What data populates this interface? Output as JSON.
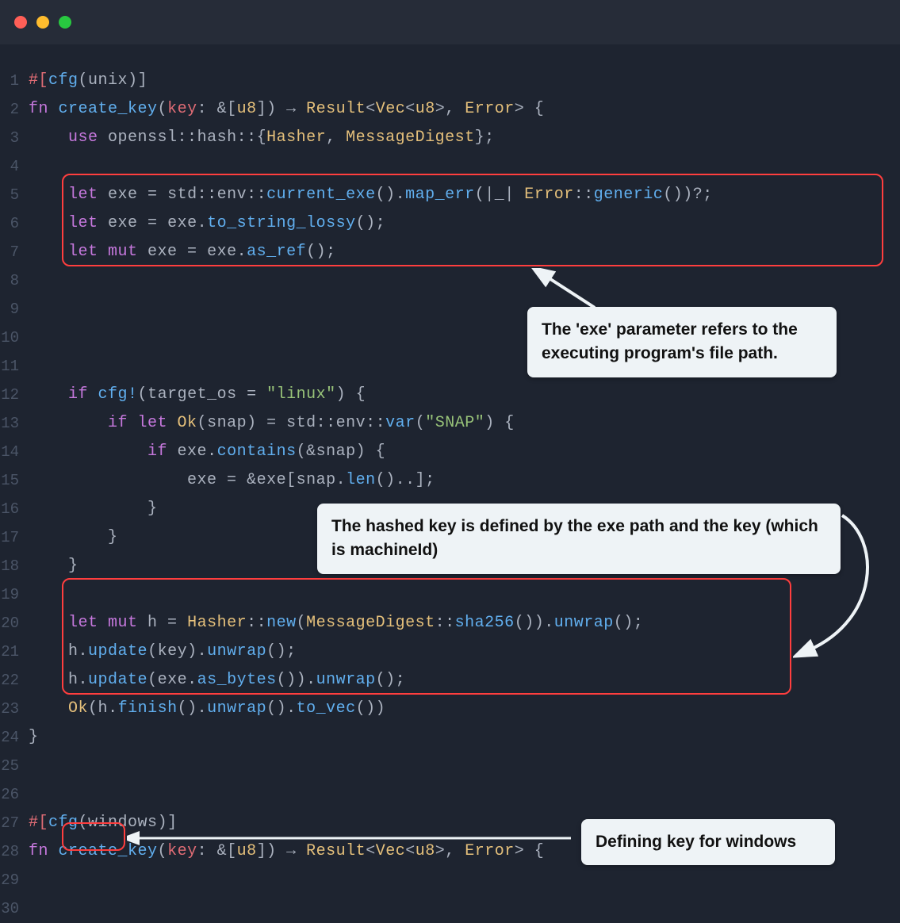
{
  "traffic_lights": [
    "red",
    "yellow",
    "green"
  ],
  "annotations": {
    "callout1": "The 'exe' parameter refers to the executing program's file path.",
    "callout2": "The hashed key is defined by the exe path and the key (which is machineId)",
    "callout3": "Defining key for windows"
  },
  "code": {
    "lines": [
      {
        "n": 1,
        "tokens": [
          [
            "tk-plain",
            "#["
          ],
          [
            "tk-call",
            "cfg"
          ],
          [
            "tk-punc",
            "("
          ],
          [
            "tk-ident",
            "unix"
          ],
          [
            "tk-punc",
            ")]"
          ]
        ]
      },
      {
        "n": 2,
        "tokens": [
          [
            "tk-kw",
            "fn "
          ],
          [
            "tk-fn",
            "create_key"
          ],
          [
            "tk-punc",
            "("
          ],
          [
            "tk-param",
            "key"
          ],
          [
            "tk-punc",
            ": "
          ],
          [
            "tk-op",
            "&"
          ],
          [
            "tk-punc",
            "["
          ],
          [
            "tk-type",
            "u8"
          ],
          [
            "tk-punc",
            "]) "
          ],
          [
            "tk-op",
            "→ "
          ],
          [
            "tk-type",
            "Result"
          ],
          [
            "tk-punc",
            "<"
          ],
          [
            "tk-type",
            "Vec"
          ],
          [
            "tk-punc",
            "<"
          ],
          [
            "tk-type",
            "u8"
          ],
          [
            "tk-punc",
            ">, "
          ],
          [
            "tk-type",
            "Error"
          ],
          [
            "tk-punc",
            "> {"
          ]
        ]
      },
      {
        "n": 3,
        "tokens": [
          [
            "tk-punc",
            "    "
          ],
          [
            "tk-kw",
            "use "
          ],
          [
            "tk-ident",
            "openssl"
          ],
          [
            "tk-op",
            "::"
          ],
          [
            "tk-ident",
            "hash"
          ],
          [
            "tk-op",
            "::"
          ],
          [
            "tk-punc",
            "{"
          ],
          [
            "tk-type",
            "Hasher"
          ],
          [
            "tk-punc",
            ", "
          ],
          [
            "tk-type",
            "MessageDigest"
          ],
          [
            "tk-punc",
            "};"
          ]
        ]
      },
      {
        "n": 4,
        "tokens": []
      },
      {
        "n": 5,
        "tokens": [
          [
            "tk-punc",
            "    "
          ],
          [
            "tk-kw",
            "let "
          ],
          [
            "tk-ident",
            "exe"
          ],
          [
            "tk-op",
            " = "
          ],
          [
            "tk-ident",
            "std"
          ],
          [
            "tk-op",
            "::"
          ],
          [
            "tk-ident",
            "env"
          ],
          [
            "tk-op",
            "::"
          ],
          [
            "tk-call",
            "current_exe"
          ],
          [
            "tk-punc",
            "()."
          ],
          [
            "tk-call",
            "map_err"
          ],
          [
            "tk-punc",
            "(|"
          ],
          [
            "tk-ident",
            "_"
          ],
          [
            "tk-punc",
            "| "
          ],
          [
            "tk-type",
            "Error"
          ],
          [
            "tk-op",
            "::"
          ],
          [
            "tk-call",
            "generic"
          ],
          [
            "tk-punc",
            "())?;"
          ]
        ]
      },
      {
        "n": 6,
        "tokens": [
          [
            "tk-punc",
            "    "
          ],
          [
            "tk-kw",
            "let "
          ],
          [
            "tk-ident",
            "exe"
          ],
          [
            "tk-op",
            " = "
          ],
          [
            "tk-ident",
            "exe"
          ],
          [
            "tk-punc",
            "."
          ],
          [
            "tk-call",
            "to_string_lossy"
          ],
          [
            "tk-punc",
            "();"
          ]
        ]
      },
      {
        "n": 7,
        "tokens": [
          [
            "tk-punc",
            "    "
          ],
          [
            "tk-kw",
            "let mut "
          ],
          [
            "tk-ident",
            "exe"
          ],
          [
            "tk-op",
            " = "
          ],
          [
            "tk-ident",
            "exe"
          ],
          [
            "tk-punc",
            "."
          ],
          [
            "tk-call",
            "as_ref"
          ],
          [
            "tk-punc",
            "();"
          ]
        ]
      },
      {
        "n": 8,
        "tokens": []
      },
      {
        "n": 9,
        "tokens": []
      },
      {
        "n": 10,
        "tokens": []
      },
      {
        "n": 11,
        "tokens": []
      },
      {
        "n": 12,
        "tokens": [
          [
            "tk-punc",
            "    "
          ],
          [
            "tk-kw",
            "if "
          ],
          [
            "tk-call",
            "cfg!"
          ],
          [
            "tk-punc",
            "("
          ],
          [
            "tk-ident",
            "target_os"
          ],
          [
            "tk-op",
            " = "
          ],
          [
            "tk-str",
            "\"linux\""
          ],
          [
            "tk-punc",
            ") {"
          ]
        ]
      },
      {
        "n": 13,
        "tokens": [
          [
            "tk-punc",
            "        "
          ],
          [
            "tk-kw",
            "if let "
          ],
          [
            "tk-type",
            "Ok"
          ],
          [
            "tk-punc",
            "("
          ],
          [
            "tk-ident",
            "snap"
          ],
          [
            "tk-punc",
            ")"
          ],
          [
            "tk-op",
            " = "
          ],
          [
            "tk-ident",
            "std"
          ],
          [
            "tk-op",
            "::"
          ],
          [
            "tk-ident",
            "env"
          ],
          [
            "tk-op",
            "::"
          ],
          [
            "tk-call",
            "var"
          ],
          [
            "tk-punc",
            "("
          ],
          [
            "tk-str",
            "\"SNAP\""
          ],
          [
            "tk-punc",
            ") {"
          ]
        ]
      },
      {
        "n": 14,
        "tokens": [
          [
            "tk-punc",
            "            "
          ],
          [
            "tk-kw",
            "if "
          ],
          [
            "tk-ident",
            "exe"
          ],
          [
            "tk-punc",
            "."
          ],
          [
            "tk-call",
            "contains"
          ],
          [
            "tk-punc",
            "("
          ],
          [
            "tk-op",
            "&"
          ],
          [
            "tk-ident",
            "snap"
          ],
          [
            "tk-punc",
            ") {"
          ]
        ]
      },
      {
        "n": 15,
        "tokens": [
          [
            "tk-punc",
            "                "
          ],
          [
            "tk-ident",
            "exe"
          ],
          [
            "tk-op",
            " = "
          ],
          [
            "tk-op",
            "&"
          ],
          [
            "tk-ident",
            "exe"
          ],
          [
            "tk-punc",
            "["
          ],
          [
            "tk-ident",
            "snap"
          ],
          [
            "tk-punc",
            "."
          ],
          [
            "tk-call",
            "len"
          ],
          [
            "tk-punc",
            "().."
          ],
          [
            "tk-punc",
            "];"
          ]
        ]
      },
      {
        "n": 16,
        "tokens": [
          [
            "tk-punc",
            "            }"
          ]
        ]
      },
      {
        "n": 17,
        "tokens": [
          [
            "tk-punc",
            "        }"
          ]
        ]
      },
      {
        "n": 18,
        "tokens": [
          [
            "tk-punc",
            "    }"
          ]
        ]
      },
      {
        "n": 19,
        "tokens": []
      },
      {
        "n": 20,
        "tokens": [
          [
            "tk-punc",
            "    "
          ],
          [
            "tk-kw",
            "let mut "
          ],
          [
            "tk-ident",
            "h"
          ],
          [
            "tk-op",
            " = "
          ],
          [
            "tk-type",
            "Hasher"
          ],
          [
            "tk-op",
            "::"
          ],
          [
            "tk-call",
            "new"
          ],
          [
            "tk-punc",
            "("
          ],
          [
            "tk-type",
            "MessageDigest"
          ],
          [
            "tk-op",
            "::"
          ],
          [
            "tk-call",
            "sha256"
          ],
          [
            "tk-punc",
            "())."
          ],
          [
            "tk-call",
            "unwrap"
          ],
          [
            "tk-punc",
            "();"
          ]
        ]
      },
      {
        "n": 21,
        "tokens": [
          [
            "tk-punc",
            "    "
          ],
          [
            "tk-ident",
            "h"
          ],
          [
            "tk-punc",
            "."
          ],
          [
            "tk-call",
            "update"
          ],
          [
            "tk-punc",
            "("
          ],
          [
            "tk-ident",
            "key"
          ],
          [
            "tk-punc",
            ")."
          ],
          [
            "tk-call",
            "unwrap"
          ],
          [
            "tk-punc",
            "();"
          ]
        ]
      },
      {
        "n": 22,
        "tokens": [
          [
            "tk-punc",
            "    "
          ],
          [
            "tk-ident",
            "h"
          ],
          [
            "tk-punc",
            "."
          ],
          [
            "tk-call",
            "update"
          ],
          [
            "tk-punc",
            "("
          ],
          [
            "tk-ident",
            "exe"
          ],
          [
            "tk-punc",
            "."
          ],
          [
            "tk-call",
            "as_bytes"
          ],
          [
            "tk-punc",
            "())."
          ],
          [
            "tk-call",
            "unwrap"
          ],
          [
            "tk-punc",
            "();"
          ]
        ]
      },
      {
        "n": 23,
        "tokens": [
          [
            "tk-punc",
            "    "
          ],
          [
            "tk-type",
            "Ok"
          ],
          [
            "tk-punc",
            "("
          ],
          [
            "tk-ident",
            "h"
          ],
          [
            "tk-punc",
            "."
          ],
          [
            "tk-call",
            "finish"
          ],
          [
            "tk-punc",
            "()."
          ],
          [
            "tk-call",
            "unwrap"
          ],
          [
            "tk-punc",
            "()."
          ],
          [
            "tk-call",
            "to_vec"
          ],
          [
            "tk-punc",
            "())"
          ]
        ]
      },
      {
        "n": 24,
        "tokens": [
          [
            "tk-punc",
            "}"
          ]
        ]
      },
      {
        "n": 25,
        "tokens": []
      },
      {
        "n": 26,
        "tokens": []
      },
      {
        "n": 27,
        "tokens": [
          [
            "tk-plain",
            "#["
          ],
          [
            "tk-call",
            "cfg"
          ],
          [
            "tk-punc",
            "("
          ],
          [
            "tk-ident",
            "windows"
          ],
          [
            "tk-punc",
            ")]"
          ]
        ]
      },
      {
        "n": 28,
        "tokens": [
          [
            "tk-kw",
            "fn "
          ],
          [
            "tk-fn",
            "create_key"
          ],
          [
            "tk-punc",
            "("
          ],
          [
            "tk-param",
            "key"
          ],
          [
            "tk-punc",
            ": "
          ],
          [
            "tk-op",
            "&"
          ],
          [
            "tk-punc",
            "["
          ],
          [
            "tk-type",
            "u8"
          ],
          [
            "tk-punc",
            "]) "
          ],
          [
            "tk-op",
            "→ "
          ],
          [
            "tk-type",
            "Result"
          ],
          [
            "tk-punc",
            "<"
          ],
          [
            "tk-type",
            "Vec"
          ],
          [
            "tk-punc",
            "<"
          ],
          [
            "tk-type",
            "u8"
          ],
          [
            "tk-punc",
            ">, "
          ],
          [
            "tk-type",
            "Error"
          ],
          [
            "tk-punc",
            "> {"
          ]
        ]
      },
      {
        "n": 29,
        "tokens": []
      },
      {
        "n": 30,
        "tokens": []
      }
    ]
  }
}
